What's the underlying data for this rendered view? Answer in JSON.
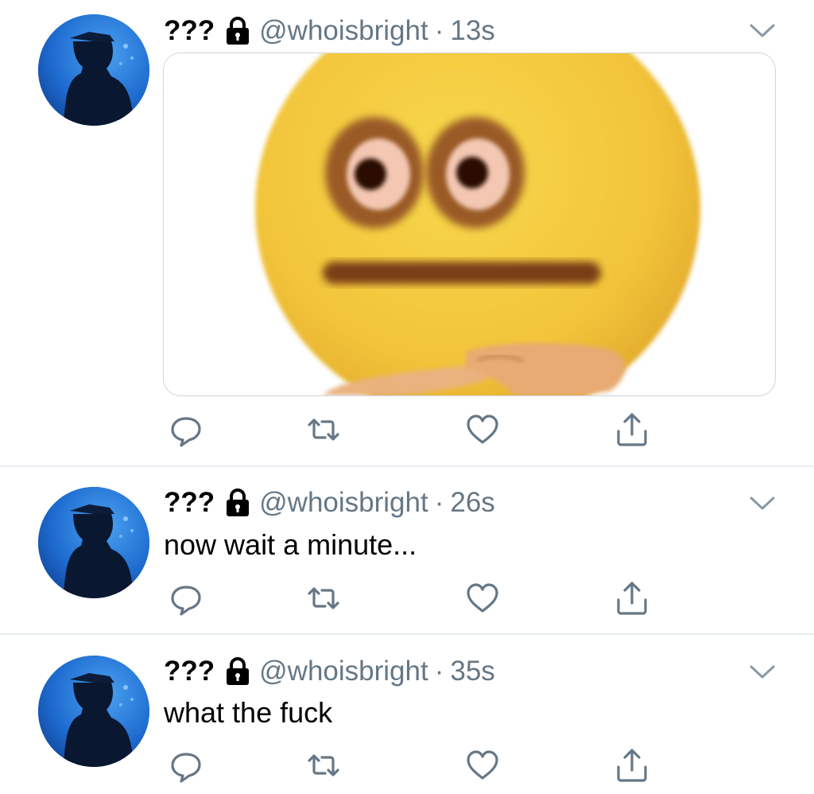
{
  "tweets": [
    {
      "display_name": "???",
      "handle": "@whoisbright",
      "separator": "·",
      "time": "13s",
      "text": "",
      "has_media": true,
      "media_icon": "cursed-emoji-image"
    },
    {
      "display_name": "???",
      "handle": "@whoisbright",
      "separator": "·",
      "time": "26s",
      "text": "now wait a minute...",
      "has_media": false
    },
    {
      "display_name": "???",
      "handle": "@whoisbright",
      "separator": "·",
      "time": "35s",
      "text": "what the fuck",
      "has_media": false
    }
  ],
  "icons": {
    "lock": "lock-icon",
    "caret": "chevron-down-icon",
    "reply": "reply-icon",
    "retweet": "retweet-icon",
    "like": "heart-icon",
    "share": "share-icon"
  },
  "colors": {
    "secondary_text": "#657786",
    "primary_text": "#000000",
    "divider": "#e6ecf0",
    "icon": "#657786"
  }
}
